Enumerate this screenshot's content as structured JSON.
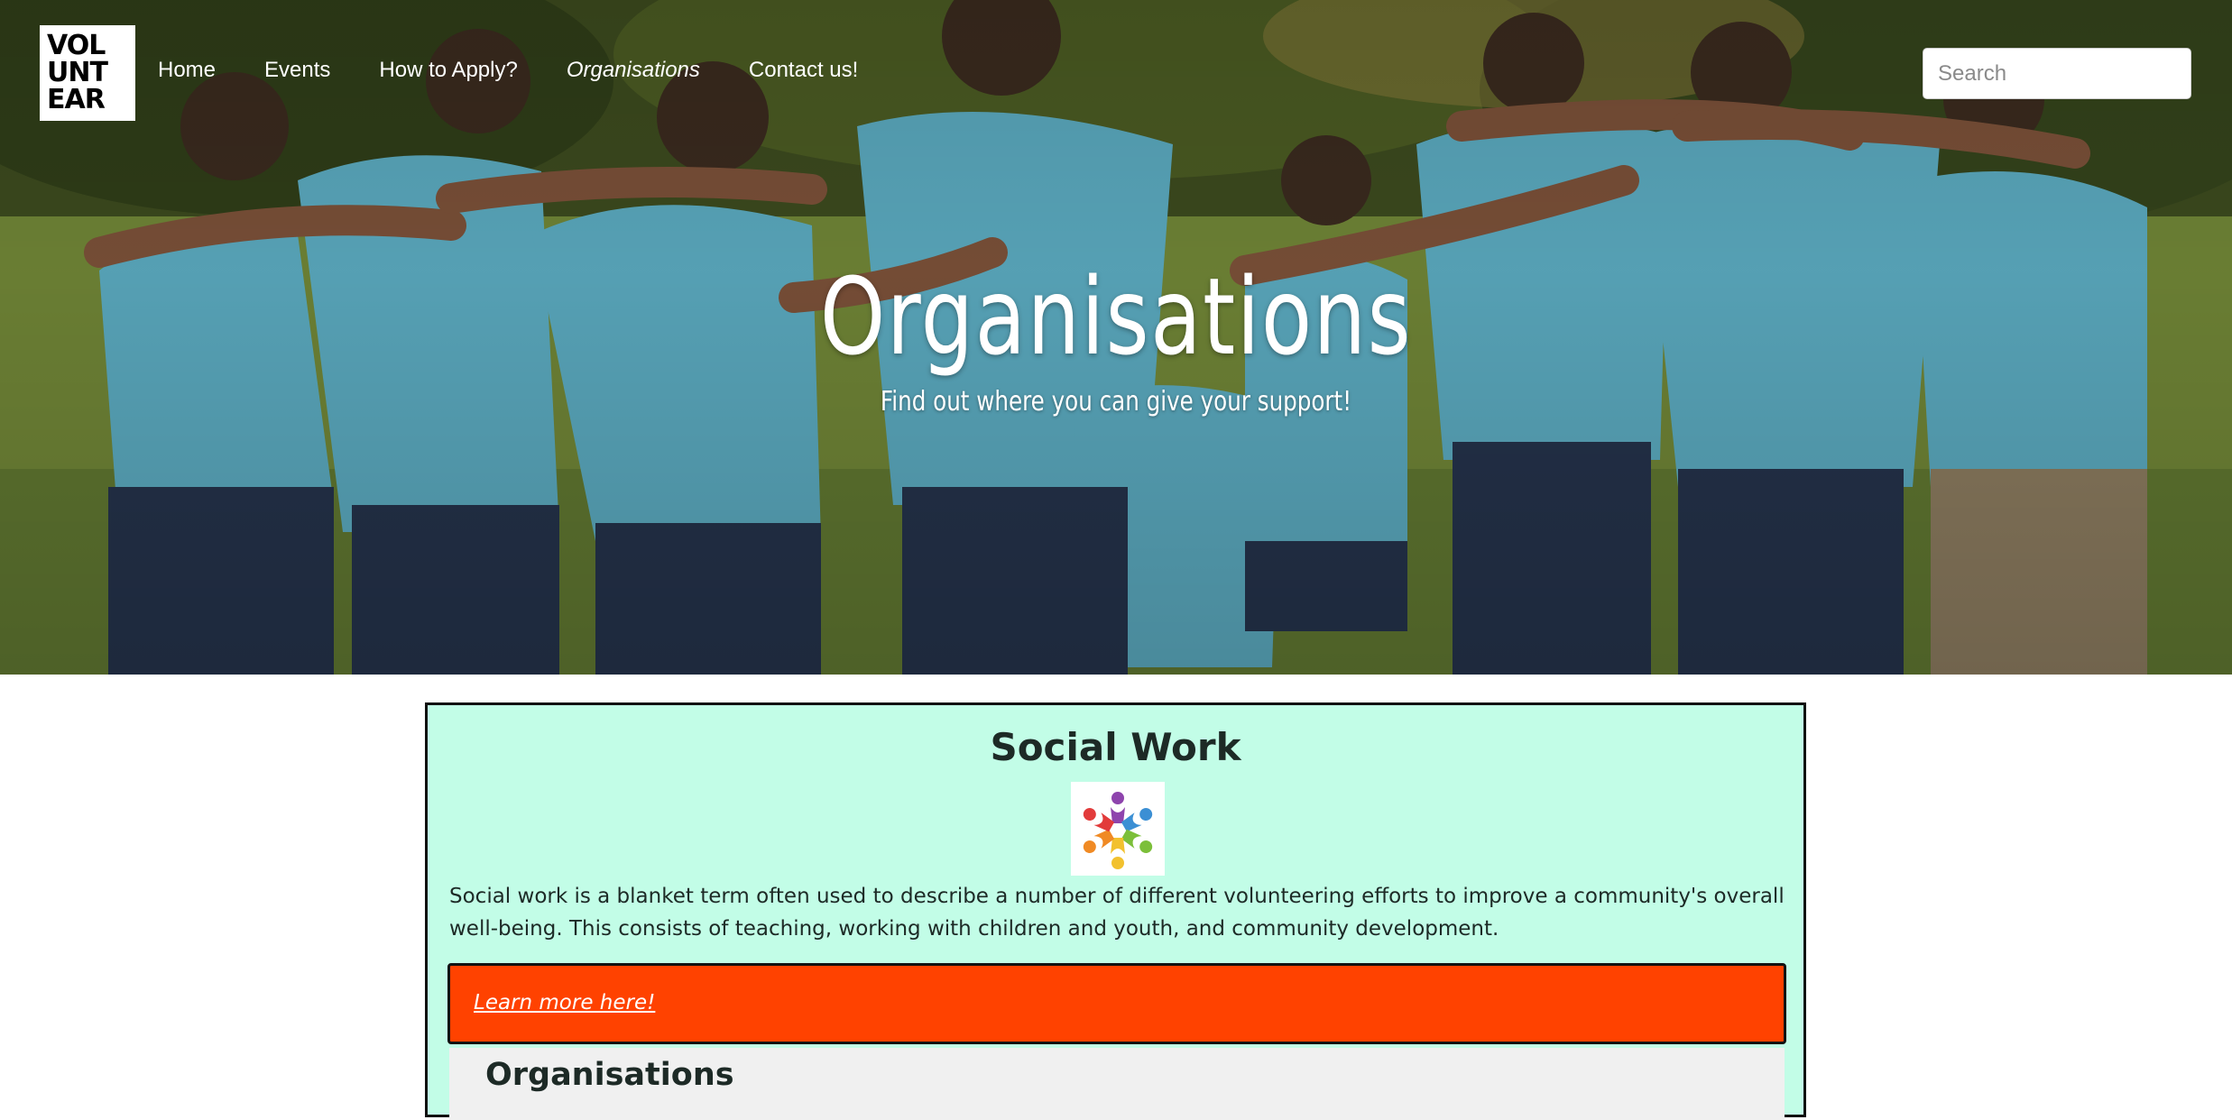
{
  "logo": {
    "lines": [
      "VOL",
      "UNT",
      "EAR"
    ]
  },
  "nav": {
    "items": [
      {
        "label": "Home"
      },
      {
        "label": "Events"
      },
      {
        "label": "How to Apply?"
      },
      {
        "label": "Organisations",
        "active": true
      },
      {
        "label": "Contact us!"
      }
    ]
  },
  "search": {
    "placeholder": "Search",
    "value": ""
  },
  "hero": {
    "title": "Organisations",
    "subtitle": "Find out where you can give your support!"
  },
  "card": {
    "title": "Social Work",
    "logo_icon": "community-circle-icon",
    "description": "Social work is a blanket term often used to describe a number of different volunteering efforts to improve a community's overall well-being. This consists of teaching, working with children and youth, and community development.",
    "learn_more": "Learn more here!",
    "organisations_heading": "Organisations"
  },
  "colors": {
    "card_bg": "#c2fde7",
    "learn_bar": "#ff4200",
    "panel_bg": "#f0f0f0",
    "nav_text": "#ffffff"
  }
}
